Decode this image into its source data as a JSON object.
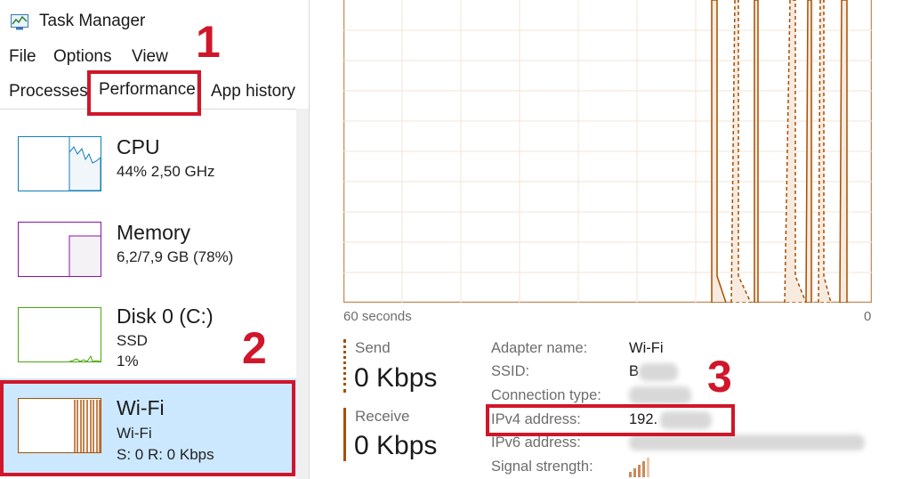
{
  "window": {
    "title": "Task Manager",
    "icon": "task-manager-icon"
  },
  "menu": [
    "File",
    "Options",
    "View"
  ],
  "tabs": [
    "Processes",
    "Performance",
    "App history"
  ],
  "selected_tab": "Performance",
  "sidebar": {
    "items": [
      {
        "title": "CPU",
        "line1": "44% 2,50 GHz",
        "line2": "",
        "color": "#117dbb"
      },
      {
        "title": "Memory",
        "line1": "6,2/7,9 GB (78%)",
        "line2": "",
        "color": "#8b12ae"
      },
      {
        "title": "Disk 0 (C:)",
        "line1": "SSD",
        "line2": "1%",
        "color": "#4da60c"
      },
      {
        "title": "Wi-Fi",
        "line1": "Wi-Fi",
        "line2": "S: 0 R: 0 Kbps",
        "color": "#a74f01"
      }
    ],
    "selected": "Wi-Fi"
  },
  "graph": {
    "x_left_label": "60 seconds",
    "x_right_label": "0",
    "color": "#a74f01",
    "grid": true
  },
  "stats": {
    "send": {
      "label": "Send",
      "value": "0 Kbps"
    },
    "receive": {
      "label": "Receive",
      "value": "0 Kbps"
    }
  },
  "properties": [
    {
      "label": "Adapter name:",
      "value": "Wi-Fi"
    },
    {
      "label": "SSID:",
      "value": "B"
    },
    {
      "label": "Connection type:",
      "value": ""
    },
    {
      "label": "IPv4 address:",
      "value": "192."
    },
    {
      "label": "IPv6 address:",
      "value": ""
    },
    {
      "label": "Signal strength:",
      "value": ""
    }
  ],
  "annotations": {
    "step1": "1",
    "step2": "2",
    "step3": "3",
    "color": "#d0162a"
  }
}
